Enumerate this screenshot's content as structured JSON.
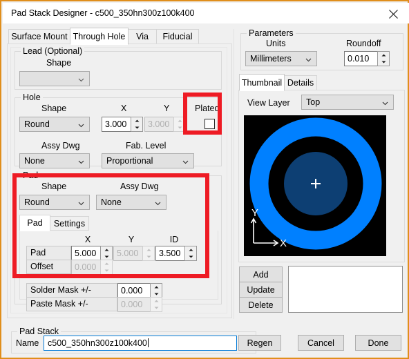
{
  "window": {
    "title": "Pad Stack Designer - c500_350hn300z100k400",
    "close_icon": "close-icon",
    "border_color": "#e08e1b"
  },
  "tabs": [
    {
      "label": "Surface Mount",
      "selected": false
    },
    {
      "label": "Through Hole",
      "selected": true
    },
    {
      "label": "Via",
      "selected": false
    },
    {
      "label": "Fiducial",
      "selected": false
    }
  ],
  "lead": {
    "group_title": "Lead (Optional)",
    "shape_label": "Shape",
    "shape_value": "",
    "shape_enabled": false
  },
  "hole": {
    "group_title": "Hole",
    "shape_label": "Shape",
    "shape_value": "Round",
    "x_label": "X",
    "x_value": "3.000",
    "x_enabled": true,
    "y_label": "Y",
    "y_value": "3.000",
    "y_enabled": false,
    "plated_label": "Plated",
    "plated_checked": false,
    "assy_dwg_label": "Assy Dwg",
    "assy_dwg_value": "None",
    "fab_level_label": "Fab. Level",
    "fab_level_value": "Proportional"
  },
  "pad": {
    "group_title": "Pad",
    "shape_label": "Shape",
    "shape_value": "Round",
    "assy_dwg_label": "Assy Dwg",
    "assy_dwg_value": "None",
    "inner_tabs": [
      {
        "label": "Pad",
        "selected": true
      },
      {
        "label": "Settings",
        "selected": false
      }
    ],
    "col_x": "X",
    "col_y": "Y",
    "col_id": "ID",
    "row_pad_label": "Pad",
    "row_offset_label": "Offset",
    "pad_x": "5.000",
    "pad_x_enabled": true,
    "pad_y": "5.000",
    "pad_y_enabled": false,
    "pad_id": "3.500",
    "pad_id_enabled": true,
    "offset_x": "0.000",
    "offset_x_enabled": false,
    "solder_mask_label": "Solder Mask +/-",
    "solder_mask_value": "0.000",
    "solder_mask_enabled": true,
    "paste_mask_label": "Paste Mask +/-",
    "paste_mask_value": "0.000",
    "paste_mask_enabled": false
  },
  "highlights": {
    "plated_color": "#ee1b24",
    "pad_color": "#ee1b24"
  },
  "parameters": {
    "group_title": "Parameters",
    "units_label": "Units",
    "units_value": "Millimeters",
    "roundoff_label": "Roundoff",
    "roundoff_value": "0.010"
  },
  "thumbnail": {
    "tabs": [
      {
        "label": "Thumbnail",
        "selected": true
      },
      {
        "label": "Details",
        "selected": false
      }
    ],
    "view_layer_label": "View Layer",
    "view_layer_value": "Top",
    "axis_x_label": "X",
    "axis_y_label": "Y",
    "pad_ring_color": "#0080ff",
    "hole_color": "#0d3f73",
    "background_color": "#000000",
    "origin_marker": "crosshair-marker"
  },
  "actions": {
    "add_label": "Add",
    "update_label": "Update",
    "delete_label": "Delete"
  },
  "padstack": {
    "group_title": "Pad Stack",
    "name_label": "Name",
    "name_value": "c500_350hn300z100k400",
    "regen_label": "Regen"
  },
  "dialog_buttons": {
    "cancel_label": "Cancel",
    "done_label": "Done"
  }
}
